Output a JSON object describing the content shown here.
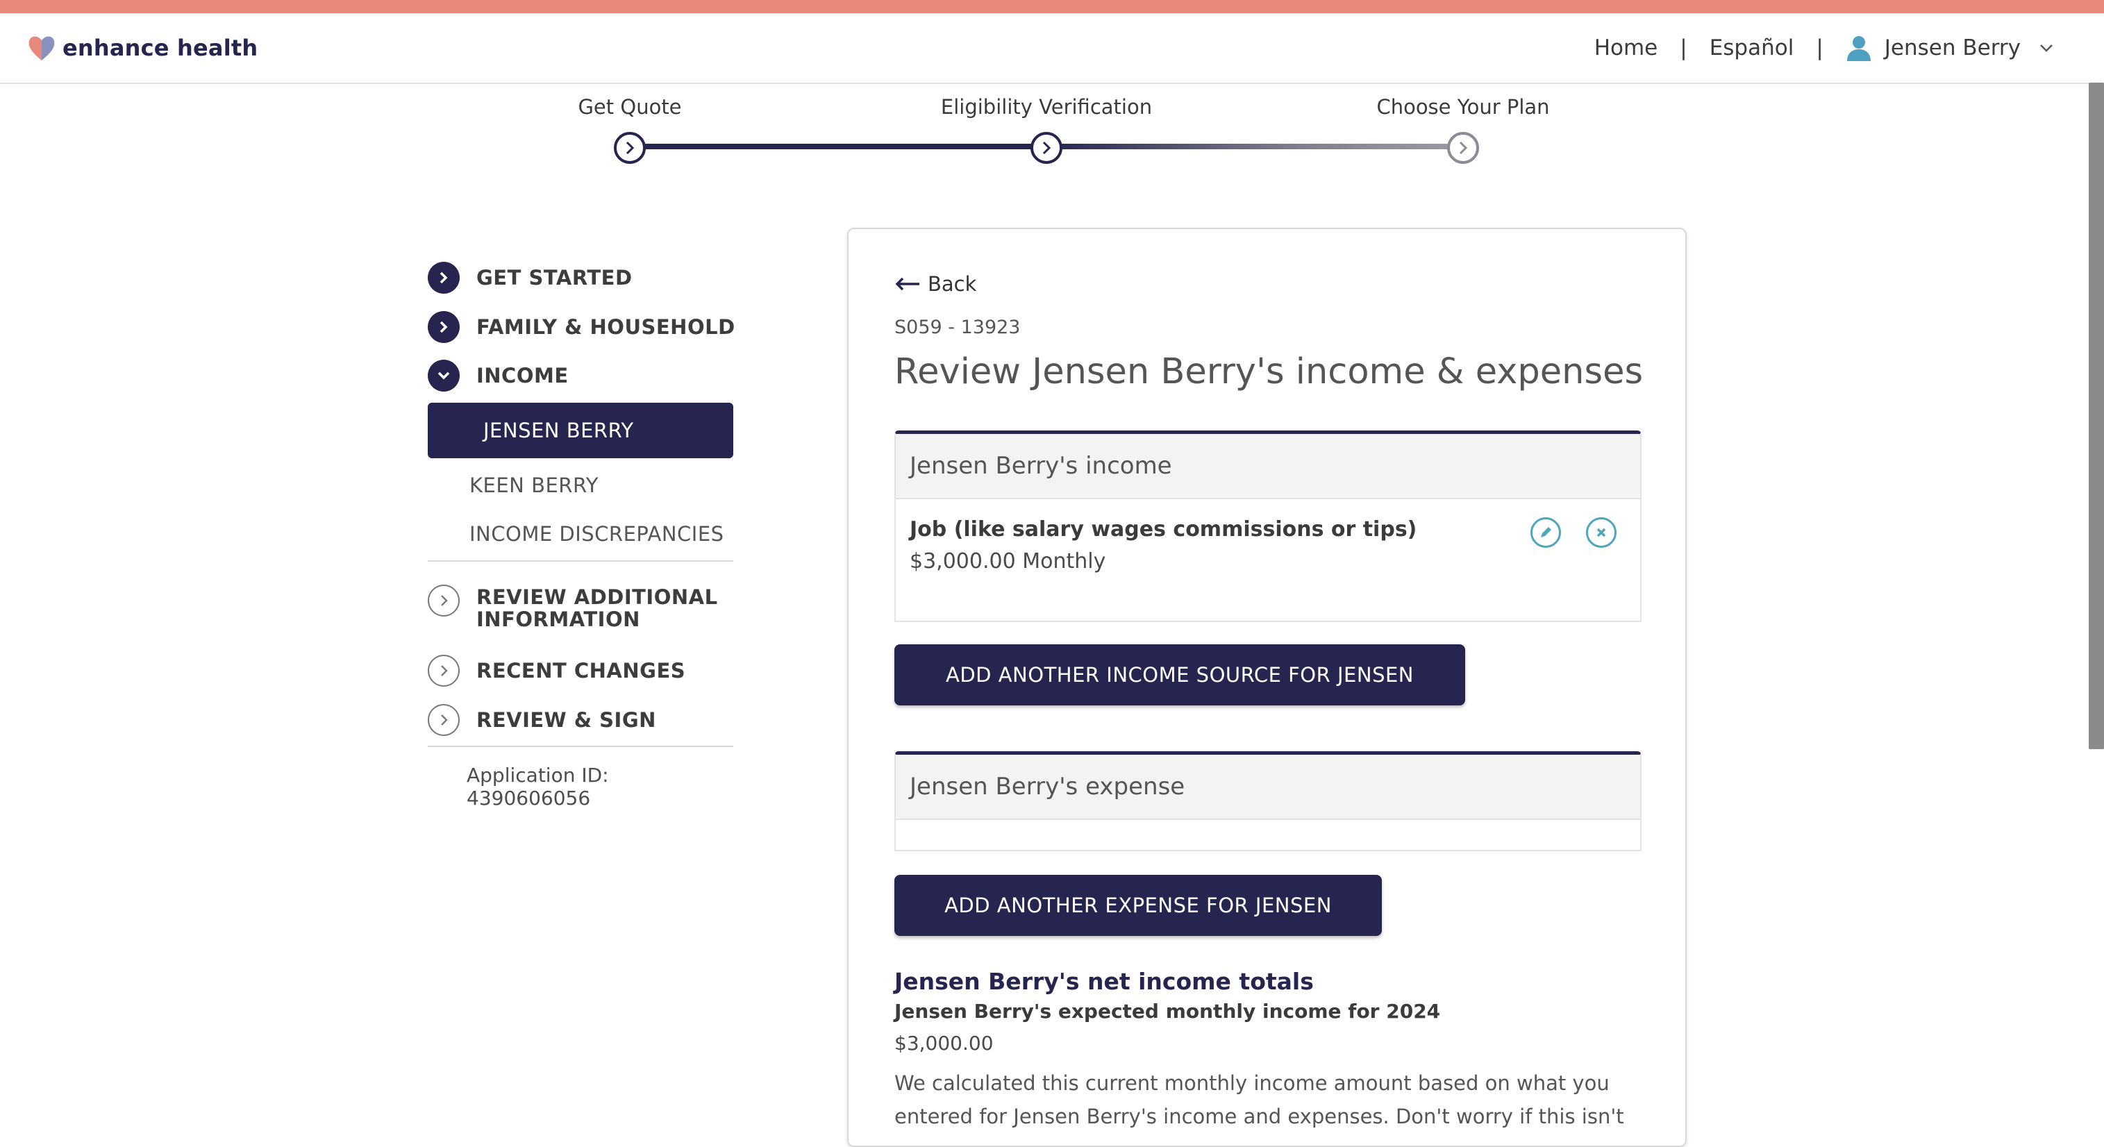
{
  "brand": {
    "name": "enhance health",
    "accent": "#e8887a",
    "primary": "#26254f"
  },
  "nav": {
    "home": "Home",
    "language": "Español",
    "separator": "|",
    "user": "Jensen Berry"
  },
  "stepper": {
    "steps": [
      "Get Quote",
      "Eligibility Verification",
      "Choose Your Plan"
    ]
  },
  "sidebar": {
    "sections": [
      "GET STARTED",
      "FAMILY & HOUSEHOLD",
      "INCOME",
      "REVIEW ADDITIONAL INFORMATION",
      "RECENT CHANGES",
      "REVIEW & SIGN"
    ],
    "income_members": [
      "JENSEN BERRY",
      "KEEN BERRY",
      "INCOME DISCREPANCIES"
    ],
    "application_id": "Application ID: 4390606056"
  },
  "main": {
    "back": "Back",
    "ref_code": "S059 - 13923",
    "title": "Review Jensen Berry's income & expenses",
    "income_section": {
      "header": "Jensen Berry's income",
      "item_title": "Job (like salary wages commissions or tips)",
      "item_amount": "$3,000.00 Monthly"
    },
    "add_income_button": "ADD ANOTHER INCOME SOURCE FOR JENSEN",
    "expense_section": {
      "header": "Jensen Berry's expense"
    },
    "add_expense_button": "ADD ANOTHER EXPENSE FOR JENSEN",
    "totals": {
      "title": "Jensen Berry's net income totals",
      "subtitle": "Jensen Berry's expected monthly income for 2024",
      "value": "$3,000.00",
      "description": "We calculated this current monthly income amount based on what you entered for Jensen Berry's income and expenses. Don't worry if this isn't"
    }
  }
}
